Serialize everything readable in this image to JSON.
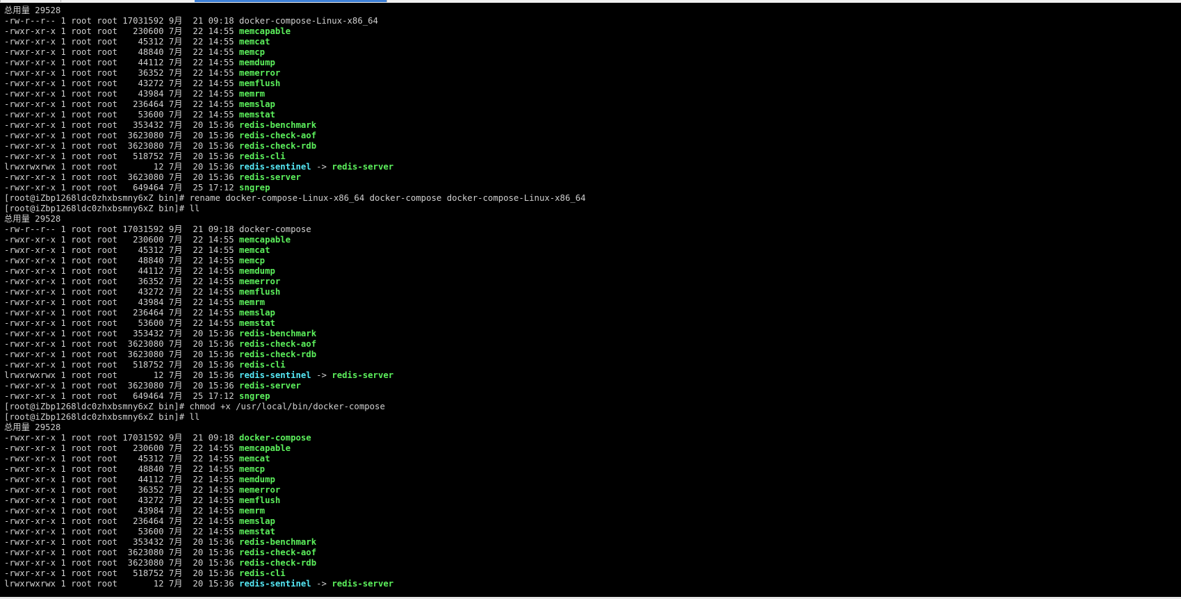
{
  "terminal": {
    "lines": [
      [
        {
          "t": "总用量 29528",
          "s": "n"
        }
      ],
      [
        {
          "t": "-rw-r--r-- 1 root root 17031592 9月  21 09:18 ",
          "s": "n"
        },
        {
          "t": "docker-compose-Linux-x86_64",
          "s": "n"
        }
      ],
      [
        {
          "t": "-rwxr-xr-x 1 root root   230600 7月  22 14:55 ",
          "s": "n"
        },
        {
          "t": "memcapable",
          "s": "g"
        }
      ],
      [
        {
          "t": "-rwxr-xr-x 1 root root    45312 7月  22 14:55 ",
          "s": "n"
        },
        {
          "t": "memcat",
          "s": "g"
        }
      ],
      [
        {
          "t": "-rwxr-xr-x 1 root root    48840 7月  22 14:55 ",
          "s": "n"
        },
        {
          "t": "memcp",
          "s": "g"
        }
      ],
      [
        {
          "t": "-rwxr-xr-x 1 root root    44112 7月  22 14:55 ",
          "s": "n"
        },
        {
          "t": "memdump",
          "s": "g"
        }
      ],
      [
        {
          "t": "-rwxr-xr-x 1 root root    36352 7月  22 14:55 ",
          "s": "n"
        },
        {
          "t": "memerror",
          "s": "g"
        }
      ],
      [
        {
          "t": "-rwxr-xr-x 1 root root    43272 7月  22 14:55 ",
          "s": "n"
        },
        {
          "t": "memflush",
          "s": "g"
        }
      ],
      [
        {
          "t": "-rwxr-xr-x 1 root root    43984 7月  22 14:55 ",
          "s": "n"
        },
        {
          "t": "memrm",
          "s": "g"
        }
      ],
      [
        {
          "t": "-rwxr-xr-x 1 root root   236464 7月  22 14:55 ",
          "s": "n"
        },
        {
          "t": "memslap",
          "s": "g"
        }
      ],
      [
        {
          "t": "-rwxr-xr-x 1 root root    53600 7月  22 14:55 ",
          "s": "n"
        },
        {
          "t": "memstat",
          "s": "g"
        }
      ],
      [
        {
          "t": "-rwxr-xr-x 1 root root   353432 7月  20 15:36 ",
          "s": "n"
        },
        {
          "t": "redis-benchmark",
          "s": "g"
        }
      ],
      [
        {
          "t": "-rwxr-xr-x 1 root root  3623080 7月  20 15:36 ",
          "s": "n"
        },
        {
          "t": "redis-check-aof",
          "s": "g"
        }
      ],
      [
        {
          "t": "-rwxr-xr-x 1 root root  3623080 7月  20 15:36 ",
          "s": "n"
        },
        {
          "t": "redis-check-rdb",
          "s": "g"
        }
      ],
      [
        {
          "t": "-rwxr-xr-x 1 root root   518752 7月  20 15:36 ",
          "s": "n"
        },
        {
          "t": "redis-cli",
          "s": "g"
        }
      ],
      [
        {
          "t": "lrwxrwxrwx 1 root root       12 7月  20 15:36 ",
          "s": "n"
        },
        {
          "t": "redis-sentinel",
          "s": "c"
        },
        {
          "t": " -> ",
          "s": "n"
        },
        {
          "t": "redis-server",
          "s": "g"
        }
      ],
      [
        {
          "t": "-rwxr-xr-x 1 root root  3623080 7月  20 15:36 ",
          "s": "n"
        },
        {
          "t": "redis-server",
          "s": "g"
        }
      ],
      [
        {
          "t": "-rwxr-xr-x 1 root root   649464 7月  25 17:12 ",
          "s": "n"
        },
        {
          "t": "sngrep",
          "s": "g"
        }
      ],
      [
        {
          "t": "[root@iZbp1268ldc0zhxbsmny6xZ bin]# rename docker-compose-Linux-x86_64 docker-compose docker-compose-Linux-x86_64",
          "s": "n"
        }
      ],
      [
        {
          "t": "[root@iZbp1268ldc0zhxbsmny6xZ bin]# ll",
          "s": "n"
        }
      ],
      [
        {
          "t": "总用量 29528",
          "s": "n"
        }
      ],
      [
        {
          "t": "-rw-r--r-- 1 root root 17031592 9月  21 09:18 ",
          "s": "n"
        },
        {
          "t": "docker-compose",
          "s": "n"
        }
      ],
      [
        {
          "t": "-rwxr-xr-x 1 root root   230600 7月  22 14:55 ",
          "s": "n"
        },
        {
          "t": "memcapable",
          "s": "g"
        }
      ],
      [
        {
          "t": "-rwxr-xr-x 1 root root    45312 7月  22 14:55 ",
          "s": "n"
        },
        {
          "t": "memcat",
          "s": "g"
        }
      ],
      [
        {
          "t": "-rwxr-xr-x 1 root root    48840 7月  22 14:55 ",
          "s": "n"
        },
        {
          "t": "memcp",
          "s": "g"
        }
      ],
      [
        {
          "t": "-rwxr-xr-x 1 root root    44112 7月  22 14:55 ",
          "s": "n"
        },
        {
          "t": "memdump",
          "s": "g"
        }
      ],
      [
        {
          "t": "-rwxr-xr-x 1 root root    36352 7月  22 14:55 ",
          "s": "n"
        },
        {
          "t": "memerror",
          "s": "g"
        }
      ],
      [
        {
          "t": "-rwxr-xr-x 1 root root    43272 7月  22 14:55 ",
          "s": "n"
        },
        {
          "t": "memflush",
          "s": "g"
        }
      ],
      [
        {
          "t": "-rwxr-xr-x 1 root root    43984 7月  22 14:55 ",
          "s": "n"
        },
        {
          "t": "memrm",
          "s": "g"
        }
      ],
      [
        {
          "t": "-rwxr-xr-x 1 root root   236464 7月  22 14:55 ",
          "s": "n"
        },
        {
          "t": "memslap",
          "s": "g"
        }
      ],
      [
        {
          "t": "-rwxr-xr-x 1 root root    53600 7月  22 14:55 ",
          "s": "n"
        },
        {
          "t": "memstat",
          "s": "g"
        }
      ],
      [
        {
          "t": "-rwxr-xr-x 1 root root   353432 7月  20 15:36 ",
          "s": "n"
        },
        {
          "t": "redis-benchmark",
          "s": "g"
        }
      ],
      [
        {
          "t": "-rwxr-xr-x 1 root root  3623080 7月  20 15:36 ",
          "s": "n"
        },
        {
          "t": "redis-check-aof",
          "s": "g"
        }
      ],
      [
        {
          "t": "-rwxr-xr-x 1 root root  3623080 7月  20 15:36 ",
          "s": "n"
        },
        {
          "t": "redis-check-rdb",
          "s": "g"
        }
      ],
      [
        {
          "t": "-rwxr-xr-x 1 root root   518752 7月  20 15:36 ",
          "s": "n"
        },
        {
          "t": "redis-cli",
          "s": "g"
        }
      ],
      [
        {
          "t": "lrwxrwxrwx 1 root root       12 7月  20 15:36 ",
          "s": "n"
        },
        {
          "t": "redis-sentinel",
          "s": "c"
        },
        {
          "t": " -> ",
          "s": "n"
        },
        {
          "t": "redis-server",
          "s": "g"
        }
      ],
      [
        {
          "t": "-rwxr-xr-x 1 root root  3623080 7月  20 15:36 ",
          "s": "n"
        },
        {
          "t": "redis-server",
          "s": "g"
        }
      ],
      [
        {
          "t": "-rwxr-xr-x 1 root root   649464 7月  25 17:12 ",
          "s": "n"
        },
        {
          "t": "sngrep",
          "s": "g"
        }
      ],
      [
        {
          "t": "[root@iZbp1268ldc0zhxbsmny6xZ bin]# chmod +x /usr/local/bin/docker-compose",
          "s": "n"
        }
      ],
      [
        {
          "t": "[root@iZbp1268ldc0zhxbsmny6xZ bin]# ll",
          "s": "n"
        }
      ],
      [
        {
          "t": "总用量 29528",
          "s": "n"
        }
      ],
      [
        {
          "t": "-rwxr-xr-x 1 root root 17031592 9月  21 09:18 ",
          "s": "n"
        },
        {
          "t": "docker-compose",
          "s": "g"
        }
      ],
      [
        {
          "t": "-rwxr-xr-x 1 root root   230600 7月  22 14:55 ",
          "s": "n"
        },
        {
          "t": "memcapable",
          "s": "g"
        }
      ],
      [
        {
          "t": "-rwxr-xr-x 1 root root    45312 7月  22 14:55 ",
          "s": "n"
        },
        {
          "t": "memcat",
          "s": "g"
        }
      ],
      [
        {
          "t": "-rwxr-xr-x 1 root root    48840 7月  22 14:55 ",
          "s": "n"
        },
        {
          "t": "memcp",
          "s": "g"
        }
      ],
      [
        {
          "t": "-rwxr-xr-x 1 root root    44112 7月  22 14:55 ",
          "s": "n"
        },
        {
          "t": "memdump",
          "s": "g"
        }
      ],
      [
        {
          "t": "-rwxr-xr-x 1 root root    36352 7月  22 14:55 ",
          "s": "n"
        },
        {
          "t": "memerror",
          "s": "g"
        }
      ],
      [
        {
          "t": "-rwxr-xr-x 1 root root    43272 7月  22 14:55 ",
          "s": "n"
        },
        {
          "t": "memflush",
          "s": "g"
        }
      ],
      [
        {
          "t": "-rwxr-xr-x 1 root root    43984 7月  22 14:55 ",
          "s": "n"
        },
        {
          "t": "memrm",
          "s": "g"
        }
      ],
      [
        {
          "t": "-rwxr-xr-x 1 root root   236464 7月  22 14:55 ",
          "s": "n"
        },
        {
          "t": "memslap",
          "s": "g"
        }
      ],
      [
        {
          "t": "-rwxr-xr-x 1 root root    53600 7月  22 14:55 ",
          "s": "n"
        },
        {
          "t": "memstat",
          "s": "g"
        }
      ],
      [
        {
          "t": "-rwxr-xr-x 1 root root   353432 7月  20 15:36 ",
          "s": "n"
        },
        {
          "t": "redis-benchmark",
          "s": "g"
        }
      ],
      [
        {
          "t": "-rwxr-xr-x 1 root root  3623080 7月  20 15:36 ",
          "s": "n"
        },
        {
          "t": "redis-check-aof",
          "s": "g"
        }
      ],
      [
        {
          "t": "-rwxr-xr-x 1 root root  3623080 7月  20 15:36 ",
          "s": "n"
        },
        {
          "t": "redis-check-rdb",
          "s": "g"
        }
      ],
      [
        {
          "t": "-rwxr-xr-x 1 root root   518752 7月  20 15:36 ",
          "s": "n"
        },
        {
          "t": "redis-cli",
          "s": "g"
        }
      ],
      [
        {
          "t": "lrwxrwxrwx 1 root root       12 7月  20 15:36 ",
          "s": "n"
        },
        {
          "t": "redis-sentinel",
          "s": "c"
        },
        {
          "t": " -> ",
          "s": "n"
        },
        {
          "t": "redis-server",
          "s": "g"
        }
      ]
    ]
  },
  "colors": {
    "background": "#000000",
    "text": "#d0d0d0",
    "executable": "#5cf05c",
    "symlink": "#55e8f5",
    "active_tab": "#3c7fd6"
  }
}
